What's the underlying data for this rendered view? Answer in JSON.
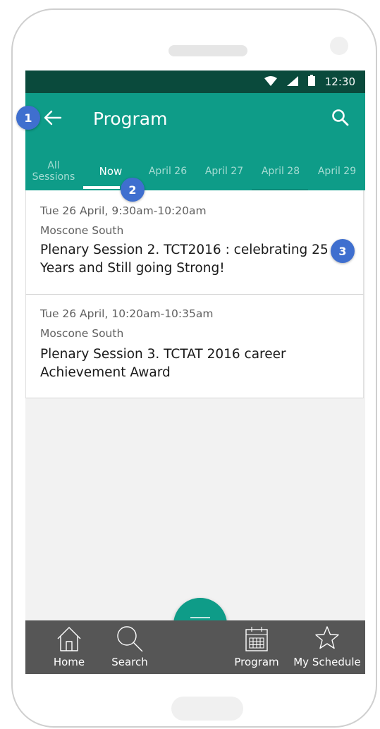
{
  "status_bar": {
    "time": "12:30"
  },
  "app_bar": {
    "title": "Program"
  },
  "tabs": [
    {
      "label_line1": "All",
      "label_line2": "Sessions"
    },
    {
      "label": "Now"
    },
    {
      "label": "April 26"
    },
    {
      "label": "April 27"
    },
    {
      "label": "April 28"
    },
    {
      "label": "April 29"
    }
  ],
  "sessions": [
    {
      "time": "Tue 26 April, 9:30am-10:20am",
      "location": "Moscone South",
      "title": "Plenary Session 2. TCT2016 : celebrating 25 Years and Still going Strong!"
    },
    {
      "time": "Tue 26 April, 10:20am-10:35am",
      "location": "Moscone South",
      "title": "Plenary Session 3. TCTAT 2016 career Achievement Award"
    }
  ],
  "badges": [
    "1",
    "2",
    "3"
  ],
  "bottom_nav": {
    "home": "Home",
    "search": "Search",
    "program": "Program",
    "my_schedule": "My Schedule"
  },
  "colors": {
    "primary": "#0e9c88",
    "status_bar": "#0a4a3c",
    "bottom_nav": "#565656",
    "badge": "#3f6fcf"
  }
}
